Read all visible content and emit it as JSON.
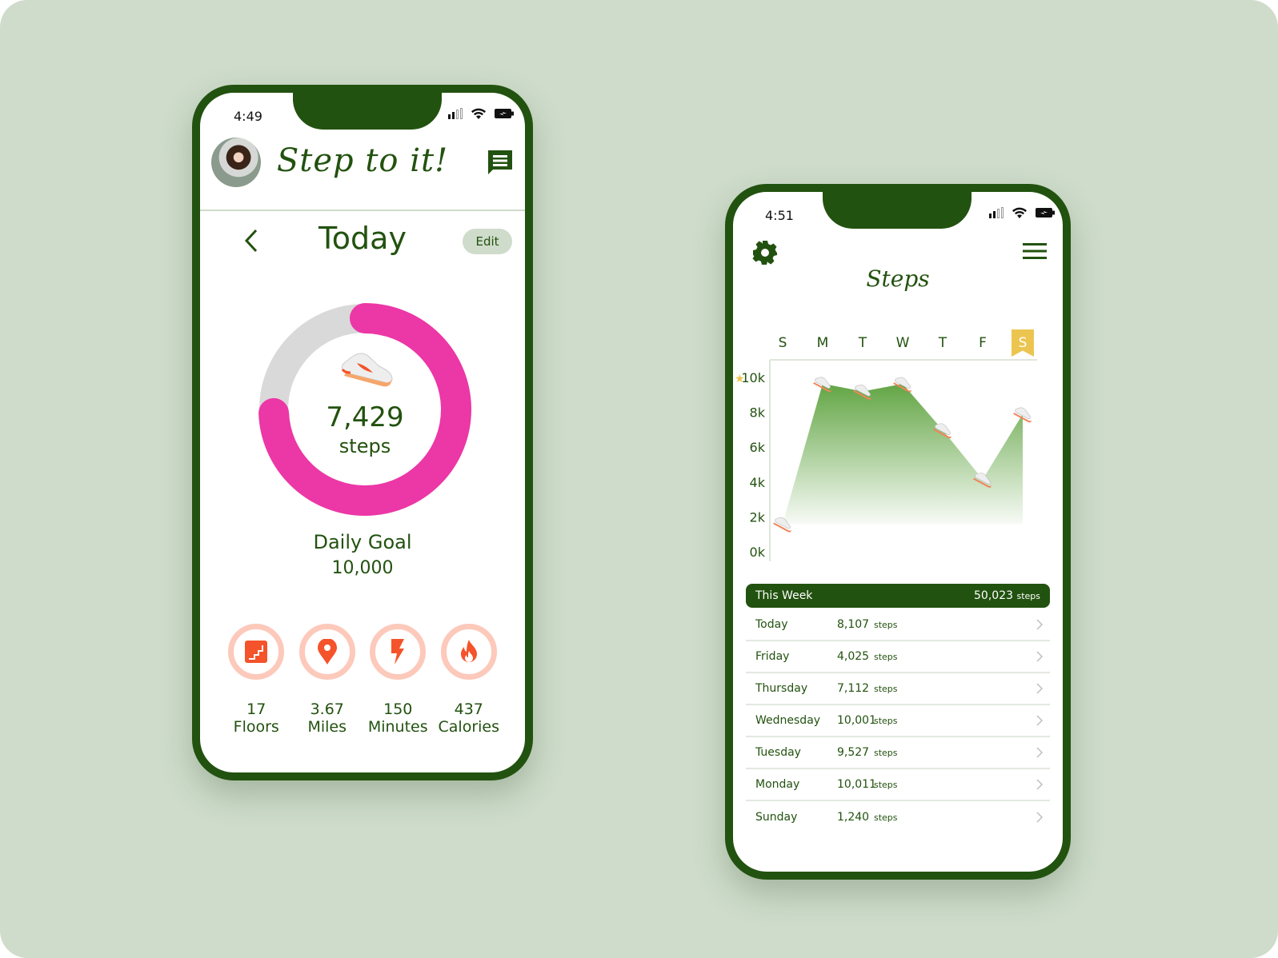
{
  "colors": {
    "brand": "#22520f",
    "background": "#cfdccb",
    "ring": "#ec37a6",
    "ring_track": "#d9d9d9",
    "metric_icon": "#f4532b",
    "metric_ring": "#fcc9bb",
    "highlight": "#ecc550"
  },
  "phone1": {
    "status": {
      "time": "4:49"
    },
    "header": {
      "title": "Step to it!",
      "avatar_icon": "user-avatar",
      "message_icon": "message-icon"
    },
    "day_nav": {
      "title": "Today",
      "edit_label": "Edit",
      "back_icon": "chevron-left-icon"
    },
    "progress": {
      "steps": "7,429",
      "steps_label": "steps",
      "fraction": 0.7429
    },
    "goal": {
      "label": "Daily Goal",
      "value": "10,000"
    },
    "metrics": [
      {
        "icon": "stairs-icon",
        "value": "17",
        "label": "Floors"
      },
      {
        "icon": "location-pin-icon",
        "value": "3.67",
        "label": "Miles"
      },
      {
        "icon": "lightning-icon",
        "value": "150",
        "label": "Minutes"
      },
      {
        "icon": "flame-icon",
        "value": "437",
        "label": "Calories"
      }
    ]
  },
  "phone2": {
    "status": {
      "time": "4:51"
    },
    "header": {
      "title": "Steps",
      "settings_icon": "gear-icon",
      "menu_icon": "hamburger-menu-icon"
    },
    "week": {
      "label": "This Week",
      "total": "50,023",
      "unit": "steps"
    },
    "rows": [
      {
        "day": "Today",
        "value": "8,107",
        "unit": "steps"
      },
      {
        "day": "Friday",
        "value": "4,025",
        "unit": "steps"
      },
      {
        "day": "Thursday",
        "value": "7,112",
        "unit": "steps"
      },
      {
        "day": "Wednesday",
        "value": "10,001",
        "unit": "steps"
      },
      {
        "day": "Tuesday",
        "value": "9,527",
        "unit": "steps"
      },
      {
        "day": "Monday",
        "value": "10,011",
        "unit": "steps"
      },
      {
        "day": "Sunday",
        "value": "1,240",
        "unit": "steps"
      }
    ]
  },
  "chart_data": {
    "type": "area",
    "title": "Steps",
    "categories": [
      "S",
      "M",
      "T",
      "W",
      "T",
      "F",
      "S"
    ],
    "highlighted_category_index": 6,
    "values": [
      1240,
      10011,
      9527,
      10001,
      7112,
      4025,
      8107
    ],
    "y_ticks": [
      "0k",
      "2k",
      "4k",
      "6k",
      "8k",
      "10k"
    ],
    "goal_marker": {
      "tick": "10k",
      "icon": "star-icon"
    },
    "ylim": [
      0,
      11000
    ],
    "marker": "shoe-icon",
    "grid": false
  }
}
